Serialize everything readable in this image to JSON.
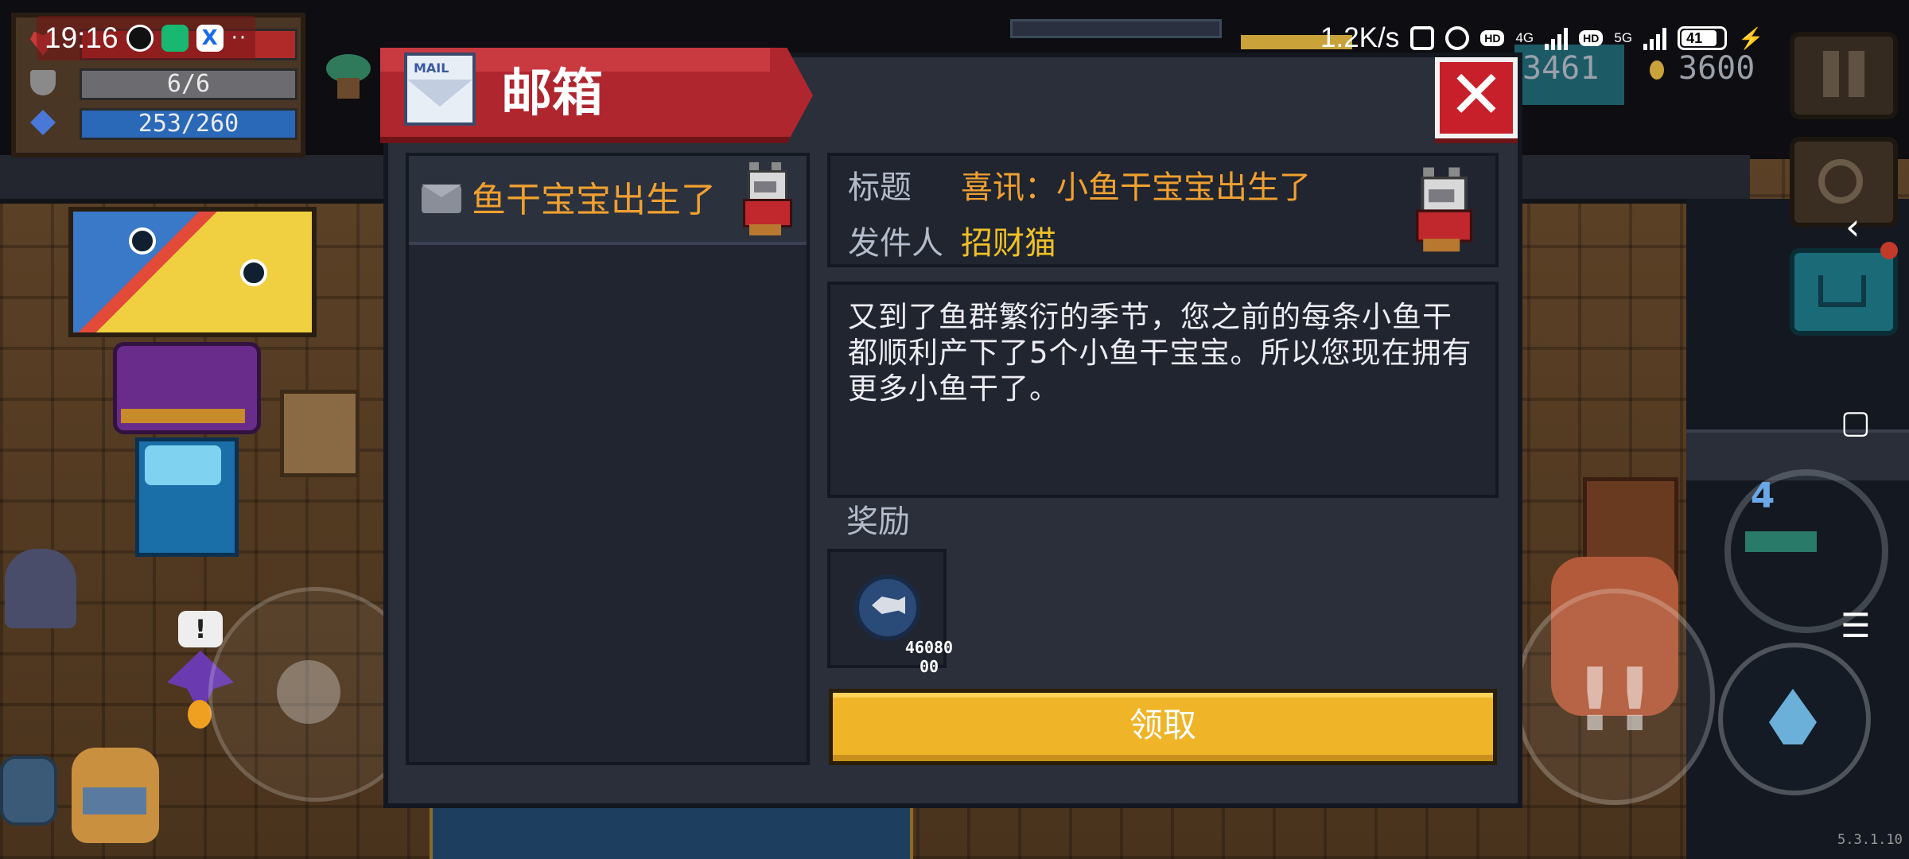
{
  "status_bar": {
    "time": "19:16",
    "left_icons": [
      "qq-icon",
      "mountain-app-icon",
      "x-app-icon"
    ],
    "more": "··",
    "net_speed": "1.2K/s",
    "signal_1": "4G",
    "signal_2": "5G",
    "hd_label": "HD",
    "battery": "41"
  },
  "hud": {
    "armor": "6/6",
    "energy": "253/260",
    "gems": "3461",
    "coins": "3600",
    "version": "5.3.1.10"
  },
  "weapon": {
    "slot_number": "4"
  },
  "npc_alert": "!",
  "mailbox": {
    "title": "邮箱",
    "close_label": "✕",
    "icon_label": "MAIL",
    "list": [
      {
        "preview": "喜讯：小鱼干宝宝出生了",
        "sender_avatar": "lucky-cat-icon",
        "read": false
      }
    ],
    "detail": {
      "subject_label": "标题",
      "subject": "喜讯：小鱼干宝宝出生了",
      "sender_label": "发件人",
      "sender": "招财猫",
      "body": "又到了鱼群繁衍的季节，您之前的每条小鱼干都顺利产下了5个小鱼干宝宝。所以您现在拥有更多小鱼干了。",
      "reward_label": "奖励",
      "rewards": [
        {
          "item_icon": "dried-fish-icon",
          "quantity_line1": "46080",
          "quantity_line2": "00"
        }
      ],
      "claim_label": "领取"
    }
  },
  "colors": {
    "ribbon_red": "#b0262e",
    "subject_orange": "#f0a030",
    "sender_yellow": "#f0c028",
    "claim_yellow": "#f0b428",
    "panel_dark": "#20252f"
  }
}
